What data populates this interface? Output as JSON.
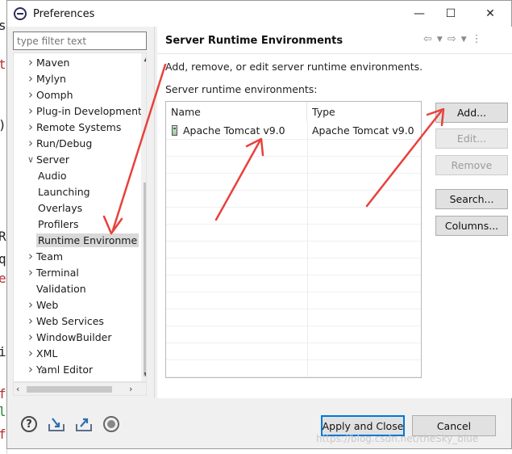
{
  "window": {
    "title": "Preferences"
  },
  "filter": {
    "placeholder": "type filter text"
  },
  "tree": {
    "items": [
      {
        "label": "Maven",
        "expandable": true,
        "level": 0
      },
      {
        "label": "Mylyn",
        "expandable": true,
        "level": 0
      },
      {
        "label": "Oomph",
        "expandable": true,
        "level": 0
      },
      {
        "label": "Plug-in Development",
        "expandable": true,
        "level": 0
      },
      {
        "label": "Remote Systems",
        "expandable": true,
        "level": 0
      },
      {
        "label": "Run/Debug",
        "expandable": true,
        "level": 0
      },
      {
        "label": "Server",
        "expandable": true,
        "expanded": true,
        "level": 0
      },
      {
        "label": "Audio",
        "level": 1
      },
      {
        "label": "Launching",
        "level": 1
      },
      {
        "label": "Overlays",
        "level": 1
      },
      {
        "label": "Profilers",
        "level": 1
      },
      {
        "label": "Runtime Environme",
        "level": 1,
        "selected": true
      },
      {
        "label": "Team",
        "expandable": true,
        "level": 0
      },
      {
        "label": "Terminal",
        "expandable": true,
        "level": 0
      },
      {
        "label": "Validation",
        "level": 0
      },
      {
        "label": "Web",
        "expandable": true,
        "level": 0
      },
      {
        "label": "Web Services",
        "expandable": true,
        "level": 0
      },
      {
        "label": "WindowBuilder",
        "expandable": true,
        "level": 0
      },
      {
        "label": "XML",
        "expandable": true,
        "level": 0
      },
      {
        "label": "Yaml Editor",
        "expandable": true,
        "level": 0
      }
    ]
  },
  "page": {
    "title": "Server Runtime Environments",
    "description": "Add, remove, or edit server runtime environments.",
    "list_label": "Server runtime environments:"
  },
  "table": {
    "columns": [
      "Name",
      "Type"
    ],
    "rows": [
      {
        "name": "Apache Tomcat v9.0",
        "type": "Apache Tomcat v9.0"
      }
    ]
  },
  "buttons": {
    "add": "Add...",
    "edit": "Edit...",
    "remove": "Remove",
    "search": "Search...",
    "columns": "Columns...",
    "apply_close": "Apply and Close",
    "cancel": "Cancel"
  },
  "watermark": "https://blog.csdn.net/theSky_blue",
  "colors": {
    "annotation_arrow": "#e8413c",
    "primary_border": "#0078d7"
  }
}
